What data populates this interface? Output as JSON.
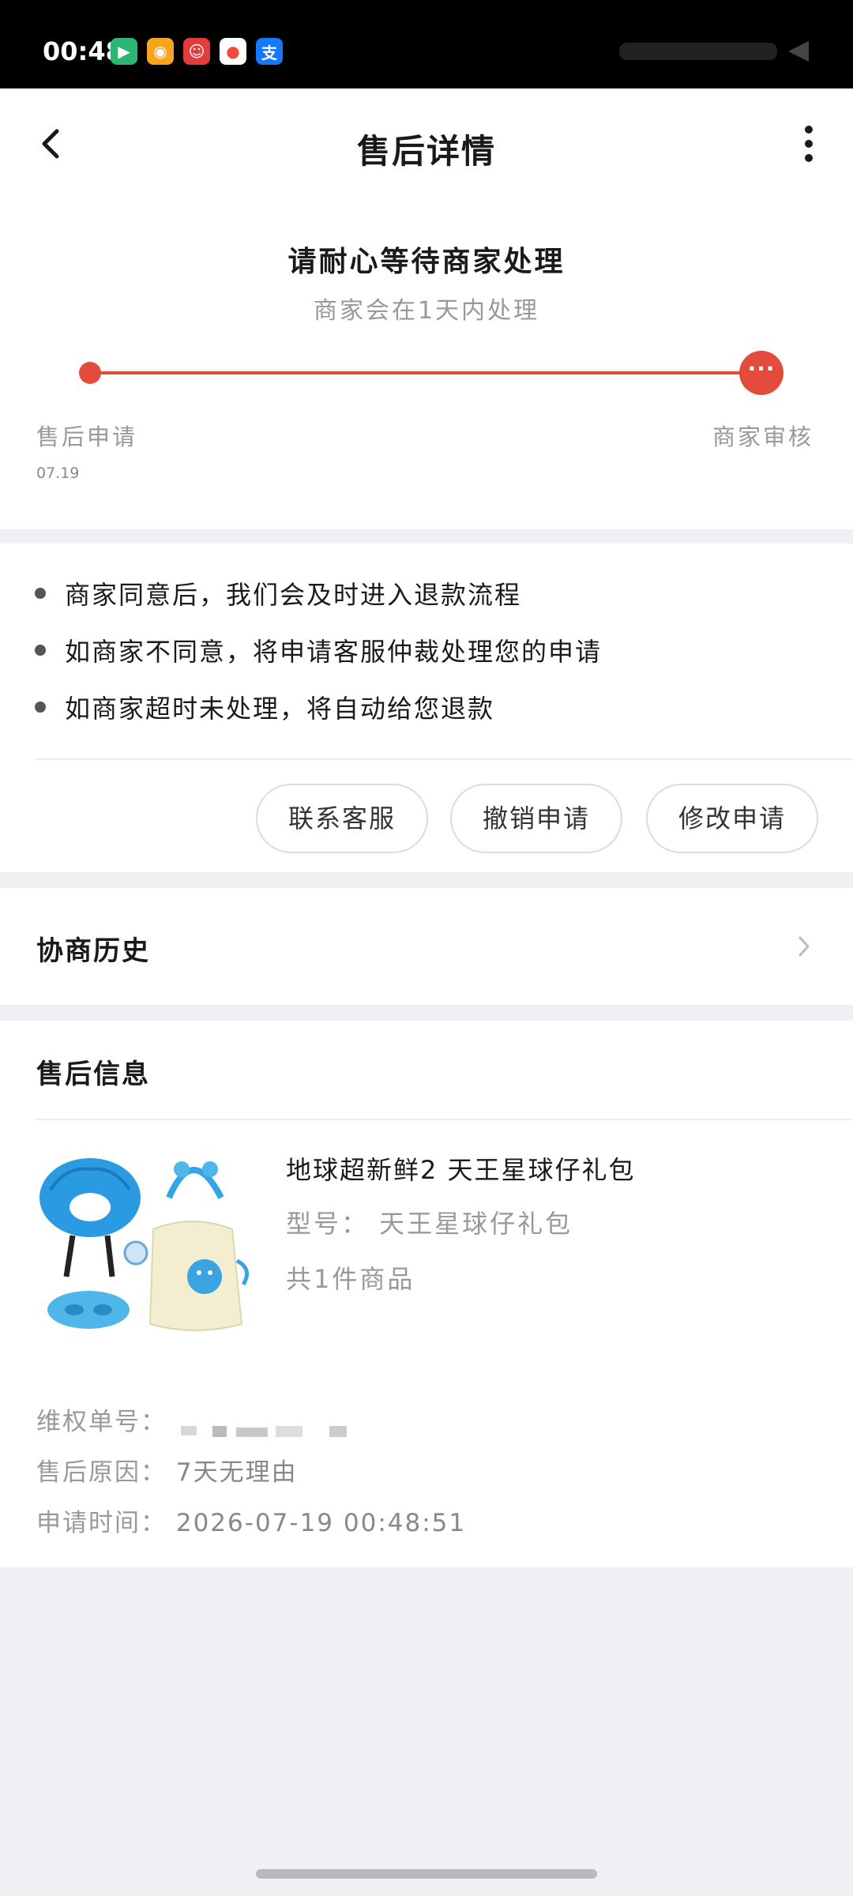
{
  "status_bar": {
    "time": "00:48",
    "app_icons": [
      {
        "name": "play-store-icon",
        "color": "#2bb673"
      },
      {
        "name": "weibo-icon",
        "color": "#f7a51c"
      },
      {
        "name": "mascot-app-icon",
        "color": "#e23c3c"
      },
      {
        "name": "maps-pin-icon",
        "color": "#f24a3b"
      },
      {
        "name": "alipay-icon",
        "color": "#1677ff",
        "glyph": "支"
      }
    ]
  },
  "header": {
    "title": "售后详情",
    "back_icon": "chevron-left-icon",
    "more_icon": "more-vertical-icon"
  },
  "status": {
    "title": "请耐心等待商家处理",
    "subtitle": "商家会在1天内处理",
    "accent_color": "#e34b3c",
    "steps": [
      {
        "label": "售后申请",
        "date": "07.19"
      },
      {
        "label": "商家审核",
        "current_icon": "ellipsis-icon"
      }
    ]
  },
  "notes": [
    "商家同意后，我们会及时进入退款流程",
    "如商家不同意，将申请客服仲裁处理您的申请",
    "如商家超时未处理，将自动给您退款"
  ],
  "actions": [
    "联系客服",
    "撤销申请",
    "修改申请"
  ],
  "history": {
    "title": "协商历史",
    "chevron_icon": "chevron-right-icon"
  },
  "info": {
    "title": "售后信息",
    "product": {
      "name": "地球超新鲜2 天王星球仔礼包",
      "model": "型号：  天王星球仔礼包",
      "count": "共1件商品"
    },
    "fields": [
      {
        "label": "维权单号：",
        "value": ""
      },
      {
        "label": "售后原因：",
        "value": "7天无理由"
      },
      {
        "label": "申请时间：",
        "value": "2026-07-19 00:48:51"
      }
    ]
  }
}
